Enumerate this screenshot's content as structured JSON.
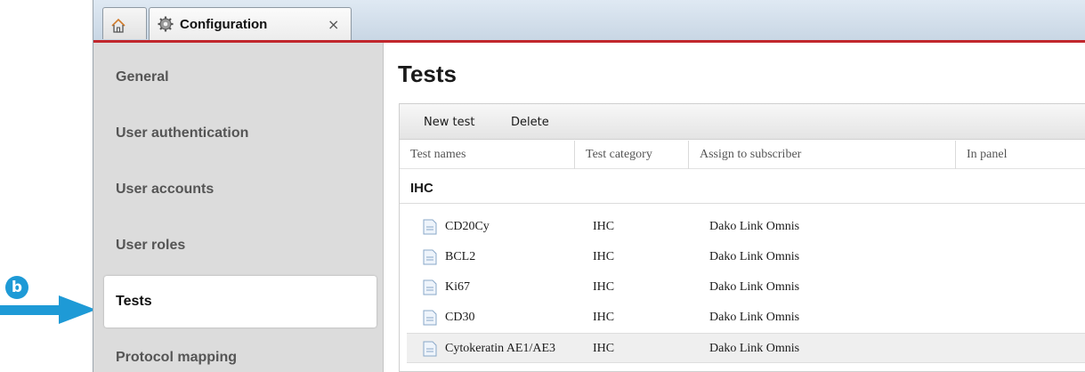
{
  "callout": {
    "badge": "b",
    "accent": "#1e9ad6"
  },
  "tabs": {
    "home": {
      "icon": "home-icon"
    },
    "config": {
      "label": "Configuration",
      "icon": "gear-icon",
      "close": "×"
    }
  },
  "sidebar": {
    "items": [
      {
        "label": "General"
      },
      {
        "label": "User authentication"
      },
      {
        "label": "User accounts"
      },
      {
        "label": "User roles"
      },
      {
        "label": "Tests",
        "active": true
      },
      {
        "label": "Protocol mapping"
      }
    ]
  },
  "main": {
    "title": "Tests",
    "toolbar": {
      "new_test": "New test",
      "delete": "Delete"
    },
    "columns": [
      "Test names",
      "Test category",
      "Assign to subscriber",
      "In panel"
    ],
    "group": "IHC",
    "rows": [
      {
        "name": "CD20Cy",
        "category": "IHC",
        "subscriber": "Dako Link Omnis"
      },
      {
        "name": "BCL2",
        "category": "IHC",
        "subscriber": "Dako Link Omnis"
      },
      {
        "name": "Ki67",
        "category": "IHC",
        "subscriber": "Dako Link Omnis"
      },
      {
        "name": "CD30",
        "category": "IHC",
        "subscriber": "Dako Link Omnis"
      },
      {
        "name": "Cytokeratin AE1/AE3",
        "category": "IHC",
        "subscriber": "Dako Link Omnis",
        "selected": true
      }
    ]
  },
  "colors": {
    "brand_red": "#c1272d",
    "sidebar_bg": "#dcdcdc"
  }
}
